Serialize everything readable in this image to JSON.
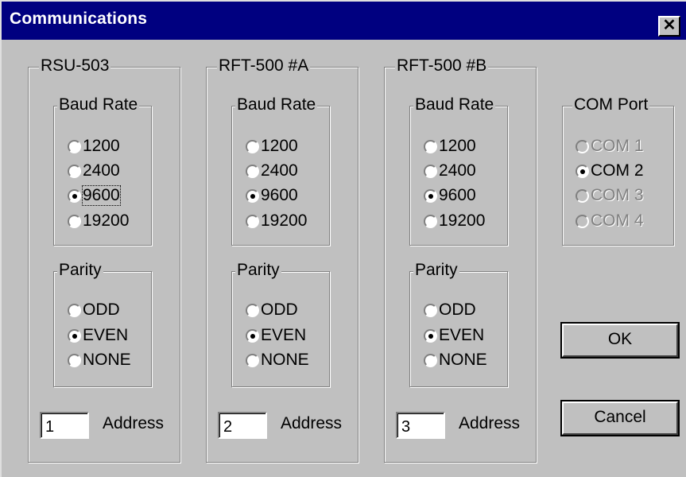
{
  "window": {
    "title": "Communications",
    "close_glyph": "✕"
  },
  "panels": [
    {
      "title": "RSU-503",
      "baud_title": "Baud Rate",
      "baud": [
        "1200",
        "2400",
        "9600",
        "19200"
      ],
      "baud_selected": 2,
      "parity_title": "Parity",
      "parity": [
        "ODD",
        "EVEN",
        "NONE"
      ],
      "parity_selected": 1,
      "address_value": "1",
      "address_label": "Address"
    },
    {
      "title": "RFT-500 #A",
      "baud_title": "Baud Rate",
      "baud": [
        "1200",
        "2400",
        "9600",
        "19200"
      ],
      "baud_selected": 2,
      "parity_title": "Parity",
      "parity": [
        "ODD",
        "EVEN",
        "NONE"
      ],
      "parity_selected": 1,
      "address_value": "2",
      "address_label": "Address"
    },
    {
      "title": "RFT-500 #B",
      "baud_title": "Baud Rate",
      "baud": [
        "1200",
        "2400",
        "9600",
        "19200"
      ],
      "baud_selected": 2,
      "parity_title": "Parity",
      "parity": [
        "ODD",
        "EVEN",
        "NONE"
      ],
      "parity_selected": 1,
      "address_value": "3",
      "address_label": "Address"
    }
  ],
  "com_port": {
    "title": "COM Port",
    "options": [
      {
        "label": "COM 1",
        "enabled": false,
        "selected": false
      },
      {
        "label": "COM 2",
        "enabled": true,
        "selected": true
      },
      {
        "label": "COM 3",
        "enabled": false,
        "selected": false
      },
      {
        "label": "COM 4",
        "enabled": false,
        "selected": false
      }
    ]
  },
  "buttons": {
    "ok": "OK",
    "cancel": "Cancel"
  }
}
